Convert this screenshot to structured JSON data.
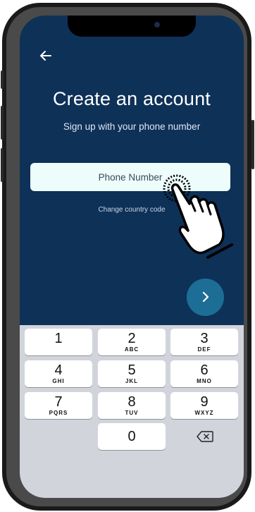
{
  "header": {
    "back_icon": "arrow-left-icon",
    "title": "Create an account",
    "subtitle": "Sign up with your phone number"
  },
  "form": {
    "phone_placeholder": "Phone Number",
    "phone_value": "",
    "change_country_label": "Change country code"
  },
  "next_button": {
    "icon": "chevron-right-icon"
  },
  "keypad": {
    "keys": [
      {
        "digit": "1",
        "letters": ""
      },
      {
        "digit": "2",
        "letters": "ABC"
      },
      {
        "digit": "3",
        "letters": "DEF"
      },
      {
        "digit": "4",
        "letters": "GHI"
      },
      {
        "digit": "5",
        "letters": "JKL"
      },
      {
        "digit": "6",
        "letters": "MNO"
      },
      {
        "digit": "7",
        "letters": "PQRS"
      },
      {
        "digit": "8",
        "letters": "TUV"
      },
      {
        "digit": "9",
        "letters": "WXYZ"
      },
      {
        "digit": "0",
        "letters": ""
      }
    ],
    "delete_icon": "backspace-icon"
  },
  "overlay": {
    "icon": "tap-hand-icon"
  },
  "colors": {
    "background": "#0e3158",
    "input": "#edfdfb",
    "next_button": "#1d6e96",
    "keyboard": "#d1d4db"
  }
}
